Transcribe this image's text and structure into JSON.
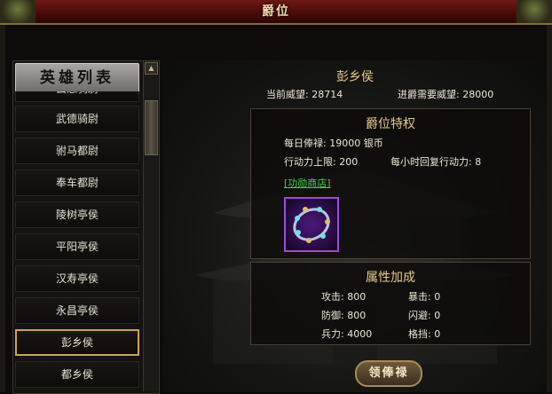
{
  "window": {
    "title": "爵位"
  },
  "hero_list": {
    "header": "英雄列表",
    "items": [
      {
        "label": "云怒骑尉"
      },
      {
        "label": "武德骑尉"
      },
      {
        "label": "驸马都尉"
      },
      {
        "label": "奉车都尉"
      },
      {
        "label": "陵树亭侯"
      },
      {
        "label": "平阳亭侯"
      },
      {
        "label": "汉寿亭侯"
      },
      {
        "label": "永昌亭侯"
      },
      {
        "label": "彭乡侯",
        "selected": true
      },
      {
        "label": "都乡侯"
      }
    ]
  },
  "detail": {
    "hero_name": "彭乡侯",
    "current_prestige_label": "当前威望:",
    "current_prestige_value": "28714",
    "required_prestige_label": "进爵需要威望:",
    "required_prestige_value": "28000"
  },
  "privilege": {
    "title": "爵位特权",
    "salary_label": "每日俸禄:",
    "salary_value": "19000",
    "salary_unit": "银币",
    "action_cap_label": "行动力上限:",
    "action_cap_value": "200",
    "action_regen_label": "每小时回复行动力:",
    "action_regen_value": "8",
    "shop_link": "[功勋商店]",
    "item_icon": "gem-bracelet-icon"
  },
  "attributes": {
    "title": "属性加成",
    "attack_label": "攻击:",
    "attack_value": "800",
    "crit_label": "暴击:",
    "crit_value": "0",
    "defense_label": "防御:",
    "defense_value": "800",
    "dodge_label": "闪避:",
    "dodge_value": "0",
    "troops_label": "兵力:",
    "troops_value": "4000",
    "block_label": "格挡:",
    "block_value": "0"
  },
  "actions": {
    "claim_salary": "领俸禄"
  },
  "colors": {
    "title_bar": "#6e1713",
    "gold_text": "#e6c98a",
    "link": "#39d84a",
    "selected_border": "#c9a64a",
    "item_frame": "#9b4bdc"
  }
}
